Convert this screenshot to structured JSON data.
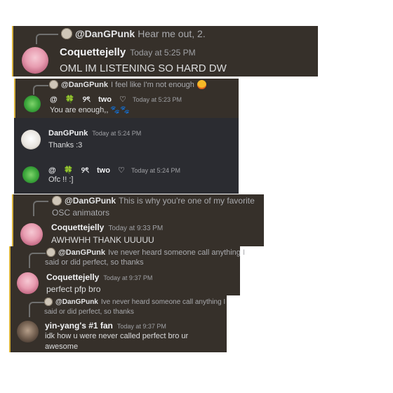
{
  "messages": [
    {
      "reply": {
        "author": "@DanGPunk",
        "text": "Hear me out, 2."
      },
      "author": "Coquettejelly",
      "time": "Today at 5:25 PM",
      "text": "OML IM LISTENING SO HARD DW"
    },
    {
      "reply": {
        "author": "@DanGPunk",
        "text": "I feel like I'm not enough"
      },
      "author_parts": [
        "@",
        "🍀",
        "୨ৎ",
        "two",
        "♡"
      ],
      "time": "Today at 5:23 PM",
      "text": "You are enough,,",
      "text_icon": "🐾🐾"
    },
    {
      "author": "DanGPunk",
      "time": "Today at 5:24 PM",
      "text": "Thanks :3"
    },
    {
      "author_parts": [
        "@",
        "🍀",
        "୨ৎ",
        "two",
        "♡"
      ],
      "time": "Today at 5:24 PM",
      "text": "Ofc !! :]"
    },
    {
      "reply": {
        "author": "@DanGPunk",
        "text": "This is why you're one of my favorite",
        "text2": "OSC animators"
      },
      "author": "Coquettejelly",
      "time": "Today at 9:33 PM",
      "text": "AWHWHH THANK UUUUU"
    },
    {
      "reply": {
        "author": "@DanGPunk",
        "text": "Ive never heard someone call anything I",
        "text2": "said or did perfect, so thanks"
      },
      "author": "Coquettejelly",
      "time": "Today at 9:37 PM",
      "text": "perfect pfp bro"
    },
    {
      "reply": {
        "author": "@DanGPunk",
        "text": "Ive never heard someone call anything I",
        "text2": "said or did perfect, so thanks"
      },
      "author": "yin-yang's #1 fan",
      "time": "Today at 9:37 PM",
      "text": "idk how u were never called perfect bro ur",
      "text2": "awesome"
    }
  ],
  "colors": {
    "panel": "#36302a",
    "panel_dark": "#2b2c31",
    "highlight_bar": "#d9b23a",
    "username": "#f2f3f5",
    "timestamp": "#9fa0a4",
    "message": "#dcddde"
  }
}
